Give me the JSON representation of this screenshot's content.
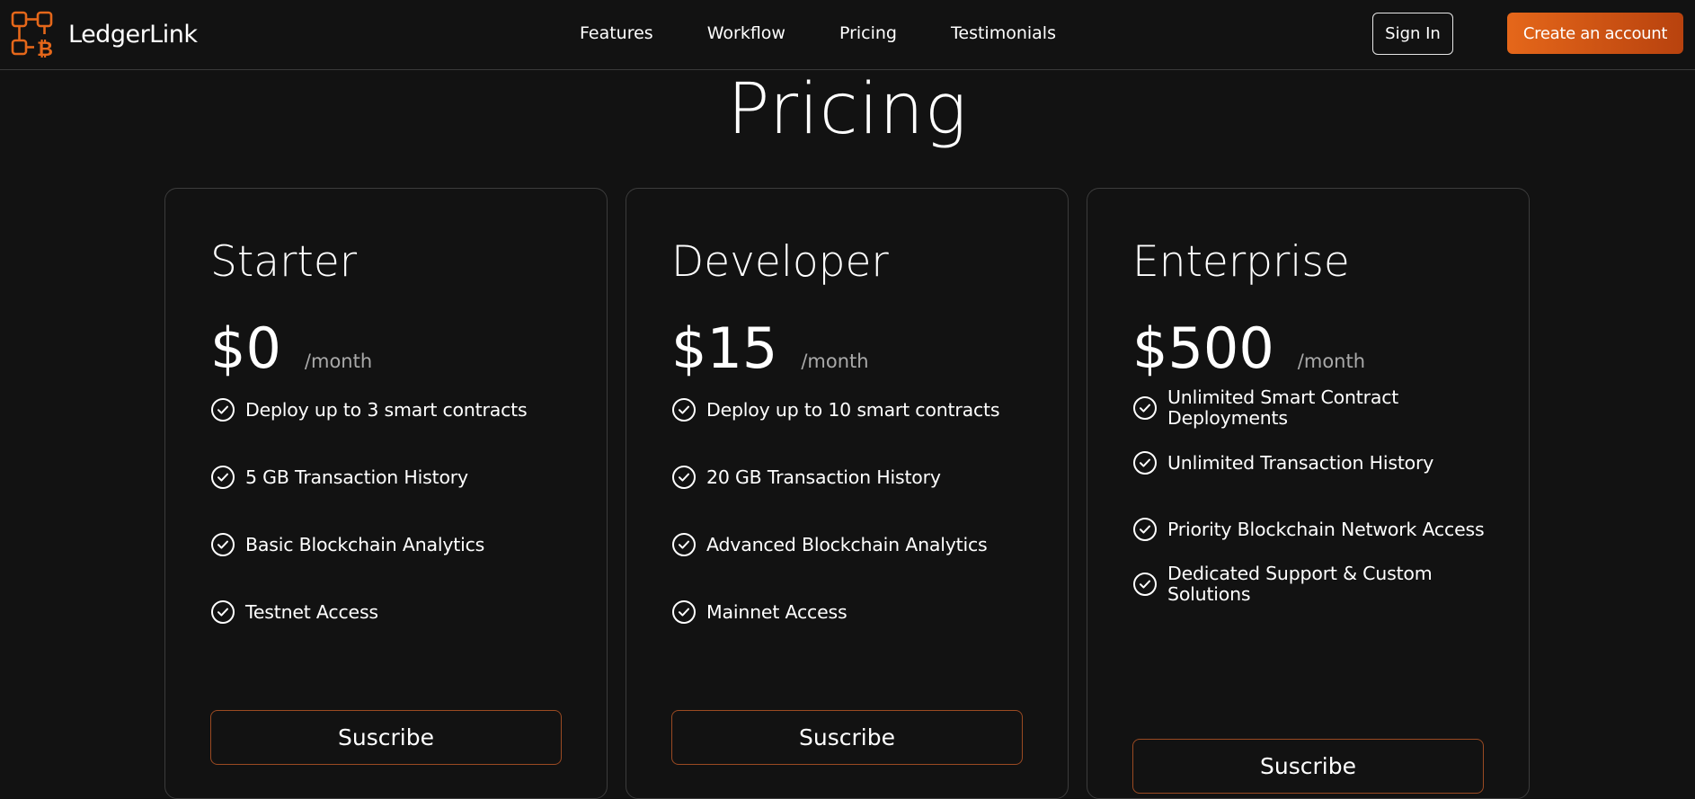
{
  "brand": {
    "name": "LedgerLink",
    "logo_icon": "bitcoin-circuit-logo-icon",
    "accent": "#e5671a"
  },
  "nav": {
    "links": [
      "Features",
      "Workflow",
      "Pricing",
      "Testimonials"
    ],
    "sign_in_label": "Sign In",
    "create_account_label": "Create an account"
  },
  "page": {
    "title": "Pricing"
  },
  "plans": [
    {
      "name": "Starter",
      "price": "$0",
      "period": "/month",
      "features": [
        "Deploy up to 3 smart contracts",
        "5 GB Transaction History",
        "Basic Blockchain Analytics",
        "Testnet Access"
      ],
      "cta": "Suscribe"
    },
    {
      "name": "Developer",
      "price": "$15",
      "period": "/month",
      "features": [
        "Deploy up to 10 smart contracts",
        "20 GB Transaction History",
        "Advanced Blockchain Analytics",
        "Mainnet Access"
      ],
      "cta": "Suscribe"
    },
    {
      "name": "Enterprise",
      "price": "$500",
      "period": "/month",
      "features": [
        "Unlimited Smart Contract Deployments",
        "Unlimited Transaction History",
        "Priority Blockchain Network Access",
        "Dedicated Support & Custom Solutions"
      ],
      "cta": "Suscribe"
    }
  ],
  "icons": {
    "feature_check": "check-circle-icon"
  }
}
